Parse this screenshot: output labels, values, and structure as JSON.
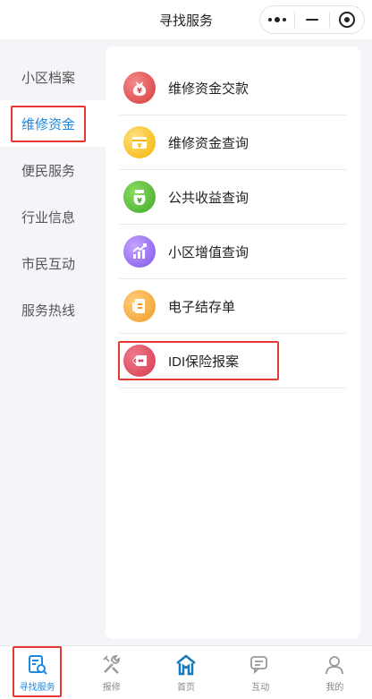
{
  "header": {
    "title": "寻找服务"
  },
  "sidebar": {
    "items": [
      {
        "label": "小区档案"
      },
      {
        "label": "维修资金"
      },
      {
        "label": "便民服务"
      },
      {
        "label": "行业信息"
      },
      {
        "label": "市民互动"
      },
      {
        "label": "服务热线"
      }
    ],
    "active": "维修资金"
  },
  "services": [
    {
      "label": "维修资金交款",
      "icon": "money-bag-icon",
      "color": "#d83a3a"
    },
    {
      "label": "维修资金查询",
      "icon": "yen-card-icon",
      "color": "#f4b400"
    },
    {
      "label": "公共收益查询",
      "icon": "yen-bag-icon",
      "color": "#3ea82a"
    },
    {
      "label": "小区增值查询",
      "icon": "chart-up-icon",
      "color": "#7e54e8"
    },
    {
      "label": "电子结存单",
      "icon": "document-icon",
      "color": "#f09a28"
    },
    {
      "label": "IDI保险报案",
      "icon": "insurance-report-icon",
      "color": "#d3394e"
    }
  ],
  "tabbar": {
    "items": [
      {
        "label": "寻找服务",
        "icon": "search-document-icon"
      },
      {
        "label": "报修",
        "icon": "tools-icon"
      },
      {
        "label": "首页",
        "icon": "home-icon"
      },
      {
        "label": "互动",
        "icon": "chat-icon"
      },
      {
        "label": "我的",
        "icon": "user-icon"
      }
    ],
    "active": "寻找服务"
  },
  "colors": {
    "accent": "#1e88e5",
    "highlight_box": "#e53935"
  }
}
